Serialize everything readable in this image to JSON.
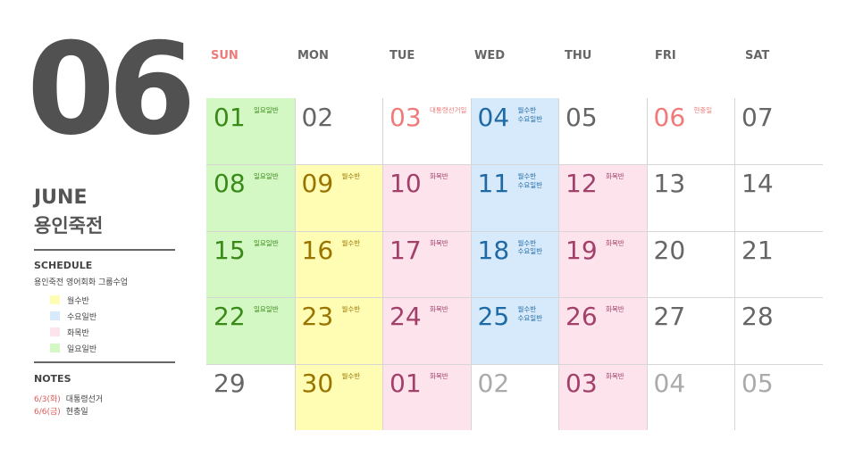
{
  "header": {
    "month_number": "06",
    "month_name": "JUNE",
    "place": "용인죽전"
  },
  "schedule": {
    "title": "SCHEDULE",
    "description": "용인죽전 영어회화 그룹수업",
    "legend": [
      {
        "label": "월수반",
        "color": "#fefdb3"
      },
      {
        "label": "수요일반",
        "color": "#d7eafb"
      },
      {
        "label": "화목반",
        "color": "#fde4ec"
      },
      {
        "label": "일요일반",
        "color": "#d3f8c3"
      }
    ]
  },
  "notes": {
    "title": "NOTES",
    "items": [
      {
        "date": "6/3(화)",
        "text": "대통령선거"
      },
      {
        "date": "6/6(금)",
        "text": "현충일"
      }
    ]
  },
  "weekdays": [
    "SUN",
    "MON",
    "TUE",
    "WED",
    "THU",
    "FRI",
    "SAT"
  ],
  "colors": {
    "sunday_header": "#f07a7a",
    "weekday_header": "#666666",
    "green_bg": "#d3f8c3",
    "green_text": "#3a8a1a",
    "yellow_bg": "#fefdb3",
    "yellow_text": "#9a7400",
    "pink_bg": "#fde4ec",
    "pink_text": "#a3406a",
    "blue_bg": "#d7eafb",
    "blue_text": "#1f6aa5",
    "holiday_text": "#f07a7a",
    "plain_text": "#666666",
    "faded_text": "#aaaaaa"
  },
  "weeks": [
    [
      {
        "day": "01",
        "label": "일요일반",
        "style": "green"
      },
      {
        "day": "02",
        "label": "",
        "style": "plain"
      },
      {
        "day": "03",
        "label": "대통령선거일",
        "style": "holiday"
      },
      {
        "day": "04",
        "label": "월수반\n수요일반",
        "style": "blue"
      },
      {
        "day": "05",
        "label": "",
        "style": "plain"
      },
      {
        "day": "06",
        "label": "현충일",
        "style": "holiday"
      },
      {
        "day": "07",
        "label": "",
        "style": "plain"
      }
    ],
    [
      {
        "day": "08",
        "label": "일요일반",
        "style": "green"
      },
      {
        "day": "09",
        "label": "월수반",
        "style": "yellow"
      },
      {
        "day": "10",
        "label": "화목반",
        "style": "pink"
      },
      {
        "day": "11",
        "label": "월수반\n수요일반",
        "style": "blue"
      },
      {
        "day": "12",
        "label": "화목반",
        "style": "pink"
      },
      {
        "day": "13",
        "label": "",
        "style": "plain"
      },
      {
        "day": "14",
        "label": "",
        "style": "plain"
      }
    ],
    [
      {
        "day": "15",
        "label": "일요일반",
        "style": "green"
      },
      {
        "day": "16",
        "label": "월수반",
        "style": "yellow"
      },
      {
        "day": "17",
        "label": "화목반",
        "style": "pink"
      },
      {
        "day": "18",
        "label": "월수반\n수요일반",
        "style": "blue"
      },
      {
        "day": "19",
        "label": "화목반",
        "style": "pink"
      },
      {
        "day": "20",
        "label": "",
        "style": "plain"
      },
      {
        "day": "21",
        "label": "",
        "style": "plain"
      }
    ],
    [
      {
        "day": "22",
        "label": "일요일반",
        "style": "green"
      },
      {
        "day": "23",
        "label": "월수반",
        "style": "yellow"
      },
      {
        "day": "24",
        "label": "화목반",
        "style": "pink"
      },
      {
        "day": "25",
        "label": "월수반\n수요일반",
        "style": "blue"
      },
      {
        "day": "26",
        "label": "화목반",
        "style": "pink"
      },
      {
        "day": "27",
        "label": "",
        "style": "plain"
      },
      {
        "day": "28",
        "label": "",
        "style": "plain"
      }
    ],
    [
      {
        "day": "29",
        "label": "",
        "style": "plain"
      },
      {
        "day": "30",
        "label": "월수반",
        "style": "yellow"
      },
      {
        "day": "01",
        "label": "화목반",
        "style": "pink"
      },
      {
        "day": "02",
        "label": "",
        "style": "faded"
      },
      {
        "day": "03",
        "label": "화목반",
        "style": "pink"
      },
      {
        "day": "04",
        "label": "",
        "style": "faded"
      },
      {
        "day": "05",
        "label": "",
        "style": "faded"
      }
    ]
  ]
}
